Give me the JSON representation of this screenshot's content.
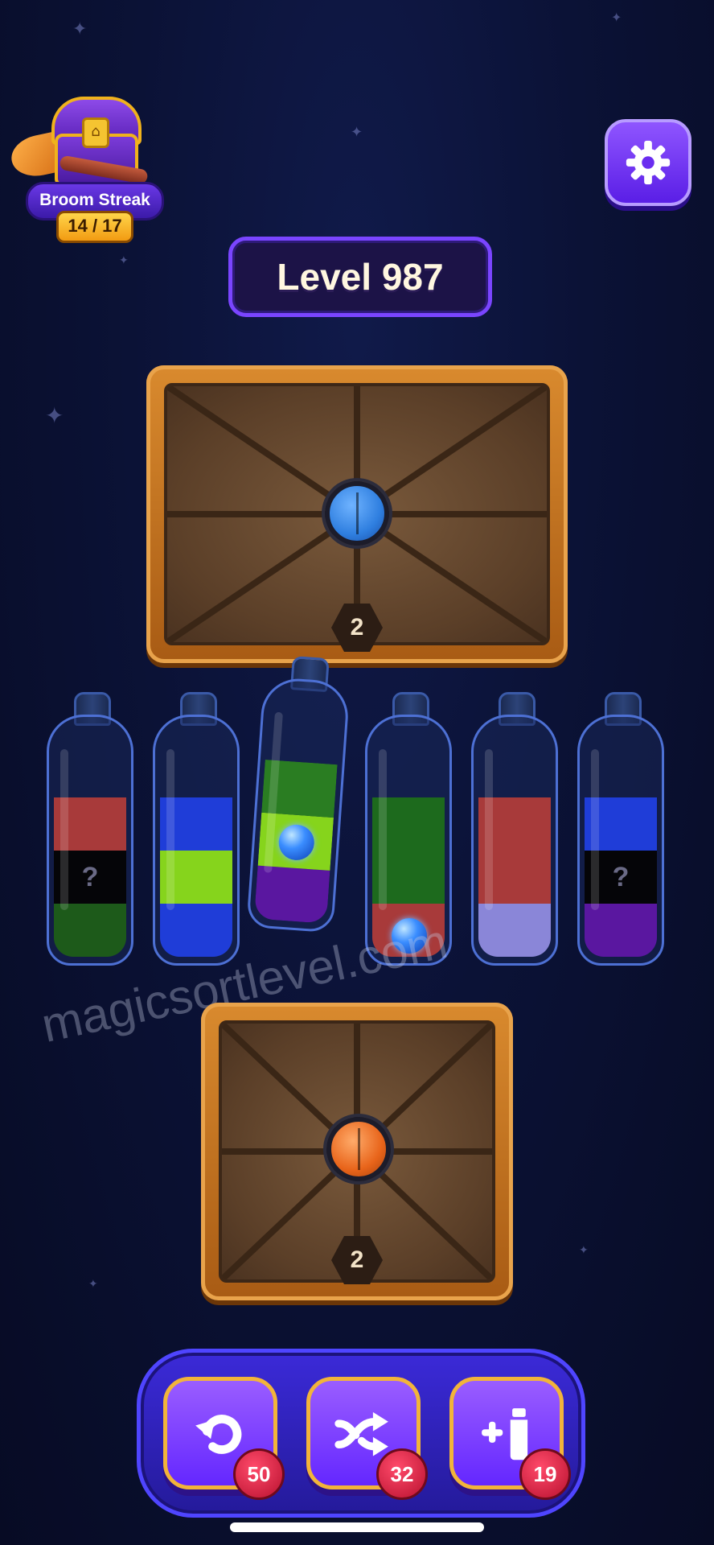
{
  "streak": {
    "label": "Broom Streak",
    "count": "14 / 17"
  },
  "level": {
    "label": "Level 987"
  },
  "crates": [
    {
      "name": "top-crate",
      "lock_color": "#2f7fe0",
      "count": "2"
    },
    {
      "name": "bottom-crate",
      "lock_color": "#e8641a",
      "count": "2"
    }
  ],
  "bottles": [
    {
      "layers_bottom_to_top": [
        "#1d5a1a",
        "hidden",
        "#a83a3a"
      ],
      "hidden_label": "?"
    },
    {
      "layers_bottom_to_top": [
        "#1f3dd8",
        "#86d41c",
        "#1f3dd8"
      ]
    },
    {
      "layers_bottom_to_top": [
        "#5a17a0",
        "#86d41c",
        "#2a7d22"
      ],
      "gem": "blue-gem",
      "selected": true
    },
    {
      "layers_bottom_to_top": [
        "#a83a3a",
        "#1d6a1d",
        "#1d6a1d"
      ],
      "gem": "blue-gem"
    },
    {
      "layers_bottom_to_top": [
        "#8a86d8",
        "#a83a3a",
        "#a83a3a"
      ]
    },
    {
      "layers_bottom_to_top": [
        "#5a17a0",
        "hidden",
        "#1f3dd8"
      ],
      "hidden_label": "?"
    }
  ],
  "watermark": "magicsortlevel.com",
  "toolbar": {
    "undo_count": "50",
    "shuffle_count": "32",
    "add_bottle_count": "19"
  },
  "colors": {
    "accent": "#6427ff",
    "gold": "#f2b43a",
    "badge_red": "#b8112f"
  },
  "icons": [
    "gear-icon",
    "undo-icon",
    "shuffle-icon",
    "add-bottle-icon",
    "treasure-chest-icon",
    "broom-icon"
  ]
}
